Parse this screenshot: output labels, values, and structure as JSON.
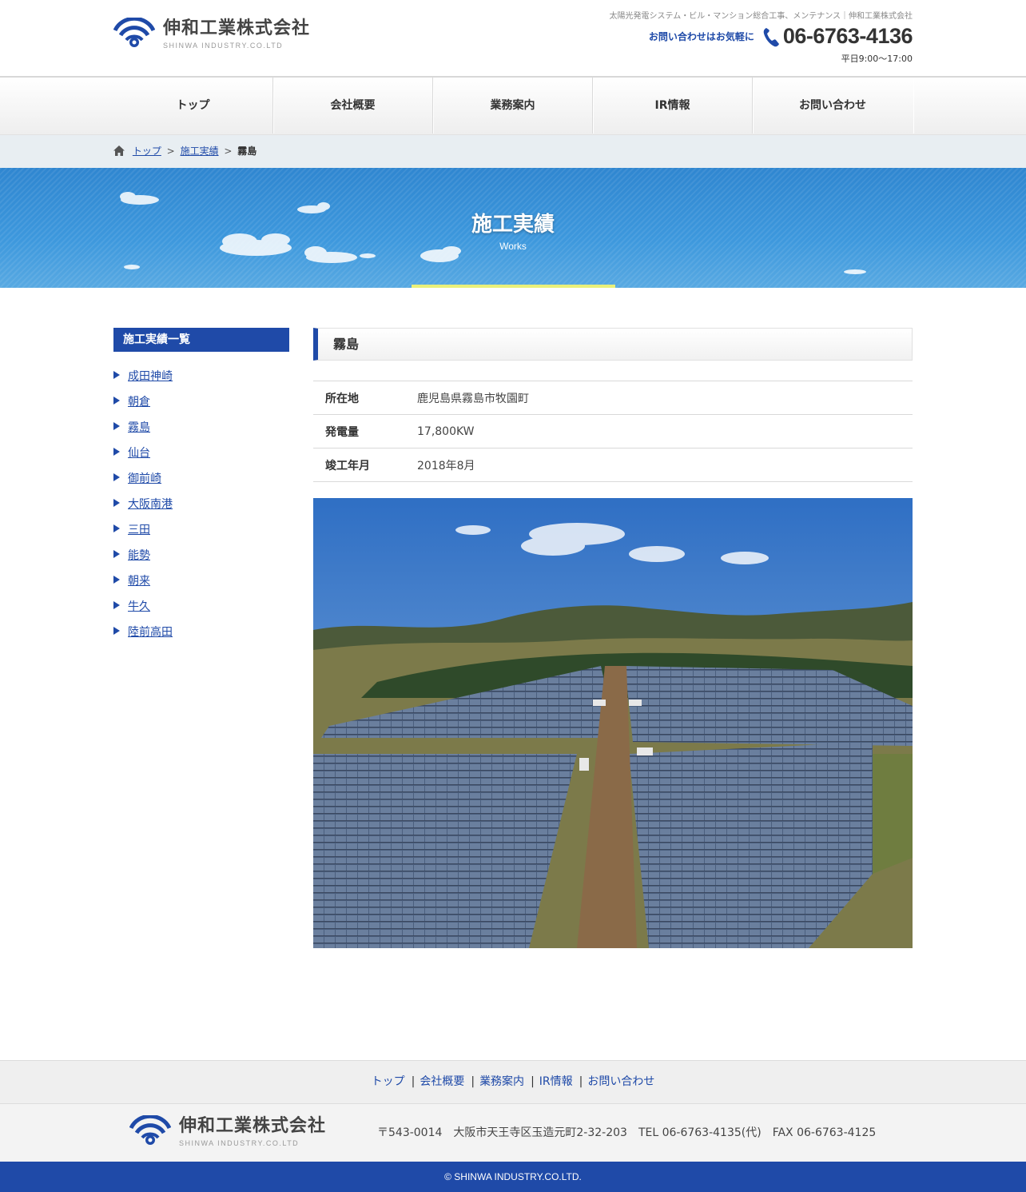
{
  "header": {
    "logo_name": "伸和工業株式会社",
    "logo_sub": "SHINWA INDUSTRY.CO.LTD",
    "tagline": "太陽光発電システム・ビル・マンション総合工事、メンテナンス｜伸和工業株式会社",
    "contact_lead": "お問い合わせはお気軽に",
    "phone": "06-6763-4136",
    "hours": "平日9:00～17:00"
  },
  "nav": {
    "items": [
      {
        "label": "トップ"
      },
      {
        "label": "会社概要"
      },
      {
        "label": "業務案内"
      },
      {
        "label": "IR情報"
      },
      {
        "label": "お問い合わせ"
      }
    ]
  },
  "breadcrumb": {
    "home": "トップ",
    "parent": "施工実績",
    "current": "霧島",
    "separator": ">"
  },
  "hero": {
    "title": "施工実績",
    "subtitle": "Works"
  },
  "sidebar": {
    "heading": "施工実績一覧",
    "items": [
      {
        "label": "成田神崎"
      },
      {
        "label": "朝倉"
      },
      {
        "label": "霧島"
      },
      {
        "label": "仙台"
      },
      {
        "label": "御前崎"
      },
      {
        "label": "大阪南港"
      },
      {
        "label": "三田"
      },
      {
        "label": "能勢"
      },
      {
        "label": "朝来"
      },
      {
        "label": "牛久"
      },
      {
        "label": "陸前高田"
      }
    ]
  },
  "article": {
    "title": "霧島",
    "specs": [
      {
        "label": "所在地",
        "value": "鹿児島県霧島市牧園町"
      },
      {
        "label": "発電量",
        "value": "17,800KW"
      },
      {
        "label": "竣工年月",
        "value": "2018年8月"
      }
    ]
  },
  "footer": {
    "nav": [
      {
        "label": "トップ"
      },
      {
        "label": "会社概要"
      },
      {
        "label": "業務案内"
      },
      {
        "label": "IR情報"
      },
      {
        "label": "お問い合わせ"
      }
    ],
    "nav_separator": "|",
    "logo_name": "伸和工業株式会社",
    "logo_sub": "SHINWA INDUSTRY.CO.LTD",
    "address": "〒543-0014　大阪市天王寺区玉造元町2-32-203　TEL 06-6763-4135(代)　FAX 06-6763-4125",
    "copyright": "© SHINWA INDUSTRY.CO.LTD."
  },
  "colors": {
    "brand_blue": "#1f4aa8",
    "hero_blue": "#3d98dd",
    "hero_accent_bar": "#eaf07a"
  },
  "icons": {
    "logo": "signal-wave-logo-icon",
    "phone": "phone-icon",
    "home": "home-icon",
    "list_bullet": "triangle-bullet-icon"
  }
}
